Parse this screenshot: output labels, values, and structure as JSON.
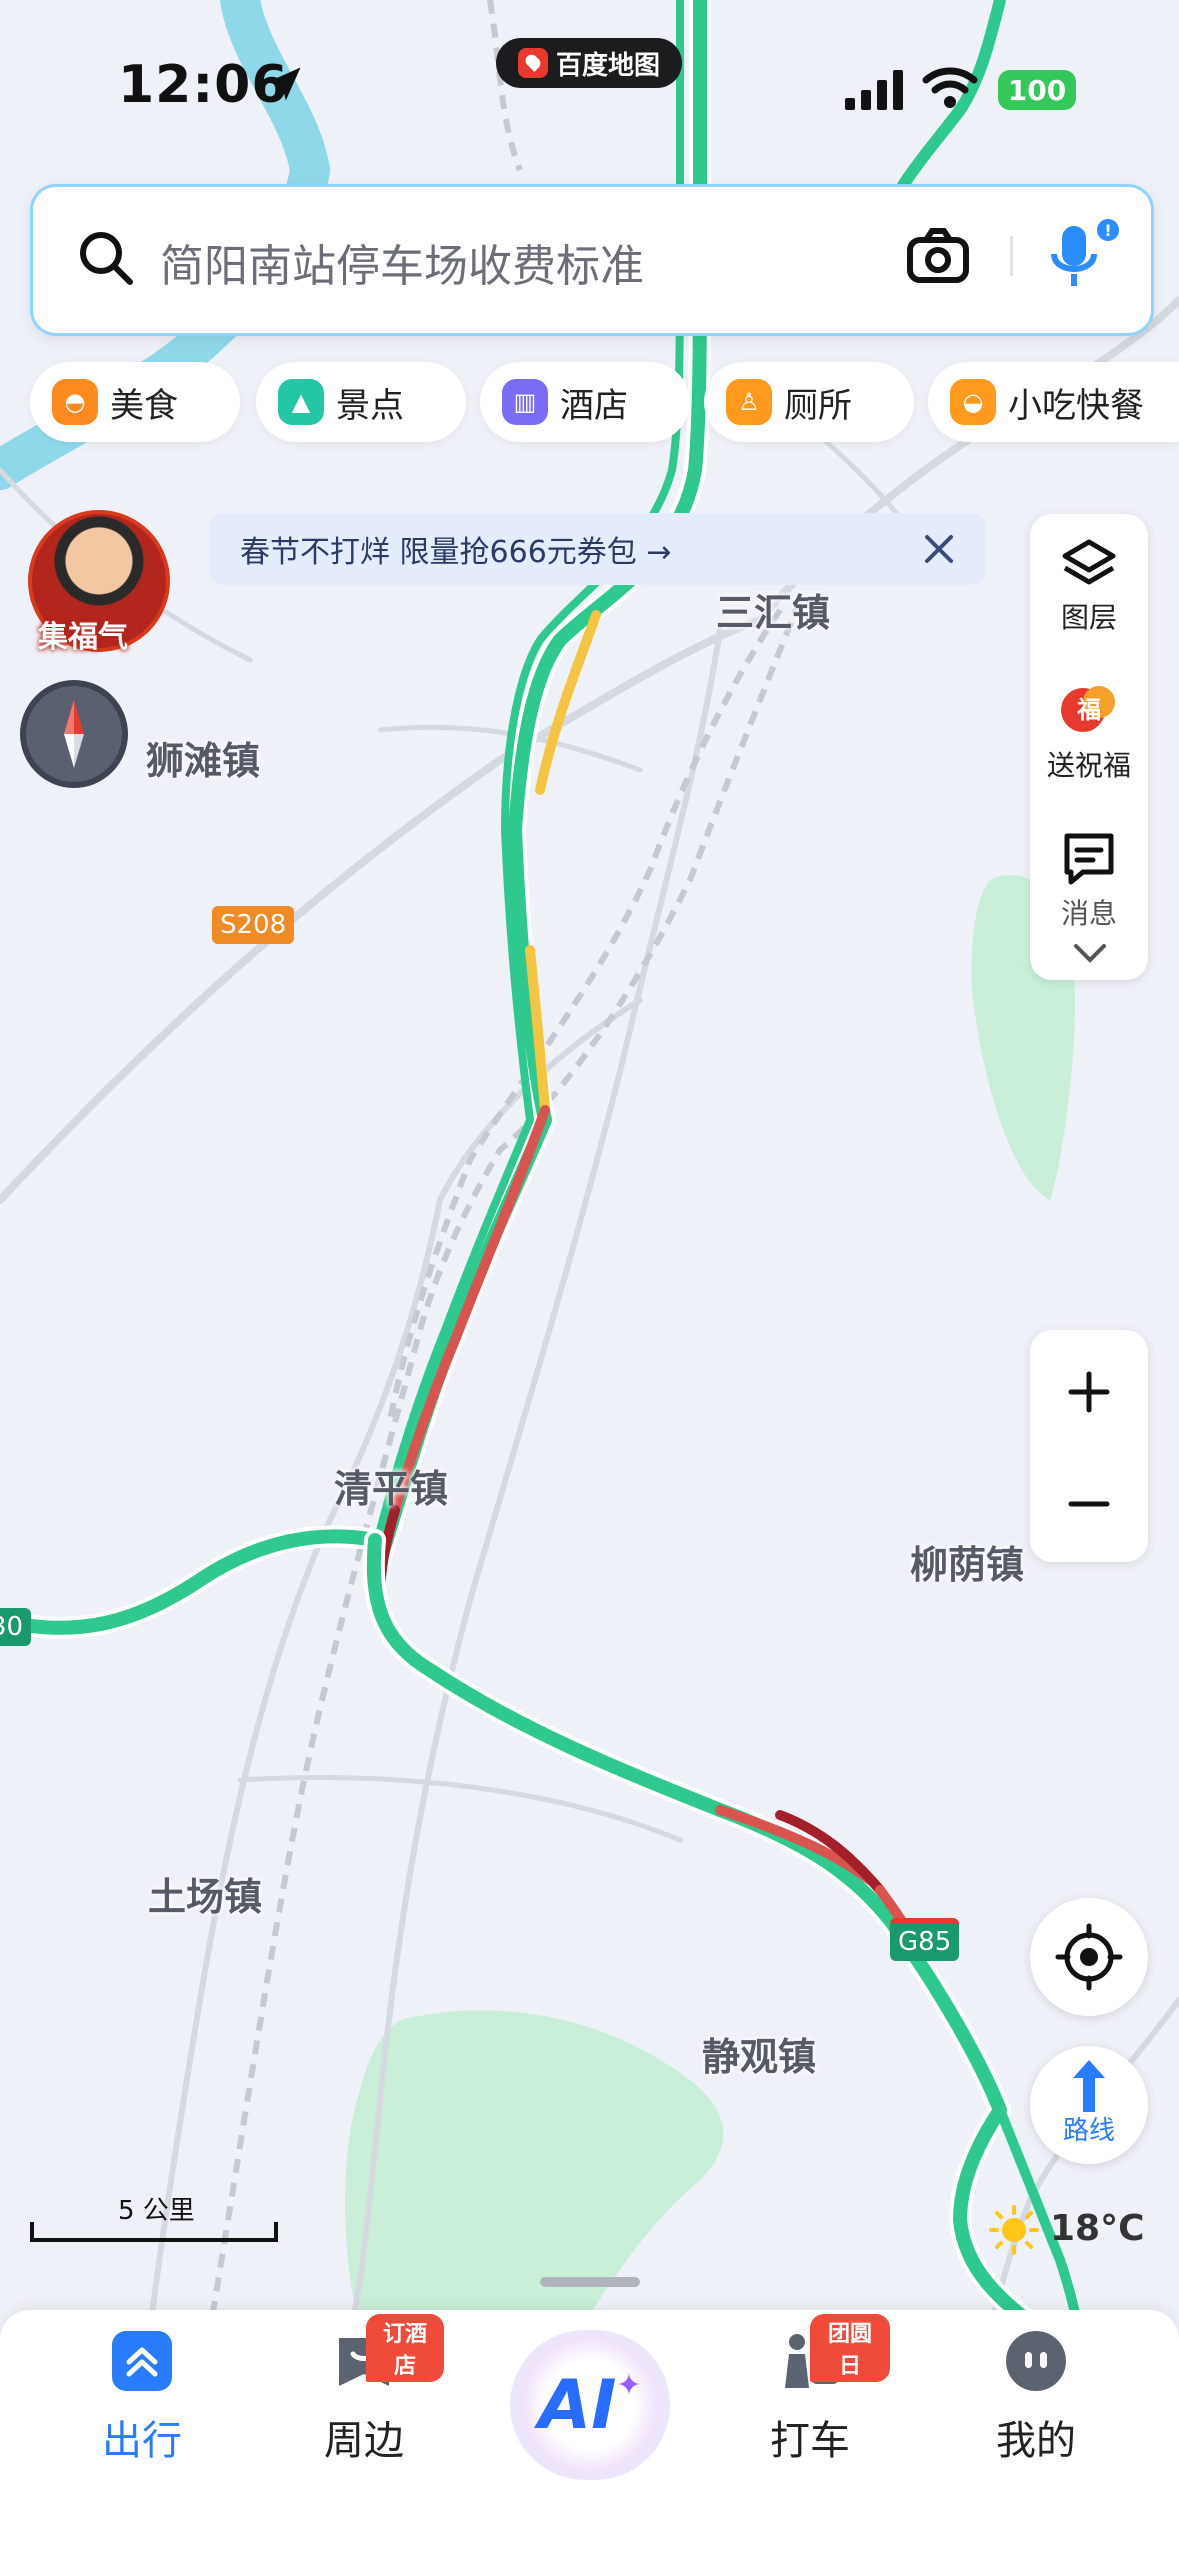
{
  "status_bar": {
    "time": "12:06",
    "app_pill": "百度地图",
    "battery": "100"
  },
  "search": {
    "placeholder": "简阳南站停车场收费标准"
  },
  "categories": [
    {
      "label": "美食",
      "color": "#ff8a1f"
    },
    {
      "label": "景点",
      "color": "#25c6a5"
    },
    {
      "label": "酒店",
      "color": "#7b6cf6"
    },
    {
      "label": "厕所",
      "color": "#ff9a1f"
    },
    {
      "label": "小吃快餐",
      "color": "#ff9a1f"
    }
  ],
  "promo": {
    "text": "春节不打烊 限量抢666元券包 →"
  },
  "avatar": {
    "label": "集福气"
  },
  "tools": {
    "layers": "图层",
    "blessing": "送祝福",
    "messages": "消息"
  },
  "map": {
    "towns": {
      "sanhui": "三汇镇",
      "shitan": "狮滩镇",
      "qingping": "清平镇",
      "liuyin": "柳荫镇",
      "tuchang": "土场镇",
      "jingguan": "静观镇"
    },
    "roads": {
      "s208": "S208",
      "g85": "G85",
      "left_edge": "30"
    },
    "scale": "5 公里",
    "route_label": "路线",
    "weather": "18°C",
    "colors": {
      "expressway": "#2fc98f",
      "congested": "#d9534f",
      "heavy": "#a31f2a",
      "slow": "#f4c542",
      "water": "#8fd8ea",
      "park": "#c9efd8"
    }
  },
  "tabbar": {
    "tabs": [
      {
        "label": "出行",
        "active": true
      },
      {
        "label": "周边",
        "badge": "订酒店"
      },
      {
        "label": "AI"
      },
      {
        "label": "打车",
        "badge": "团圆日"
      },
      {
        "label": "我的"
      }
    ]
  }
}
